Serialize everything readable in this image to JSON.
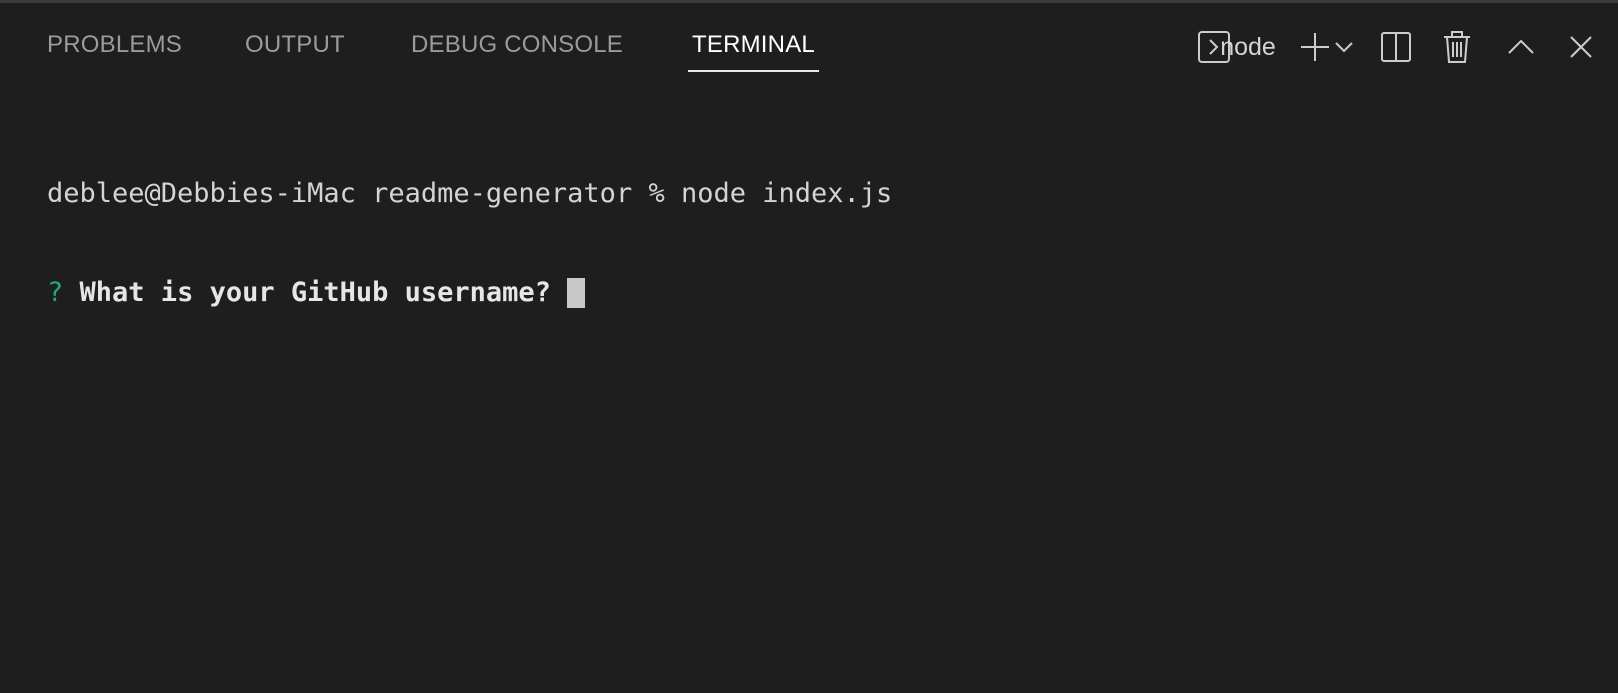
{
  "tabs": [
    {
      "label": "PROBLEMS",
      "active": false
    },
    {
      "label": "OUTPUT",
      "active": false
    },
    {
      "label": "DEBUG CONSOLE",
      "active": false
    },
    {
      "label": "TERMINAL",
      "active": true
    }
  ],
  "toolbar": {
    "terminal_name": "node",
    "icons": [
      "terminal-icon",
      "plus-icon",
      "chevron-down-icon",
      "split-icon",
      "trash-icon",
      "chevron-up-icon",
      "close-icon"
    ]
  },
  "terminal": {
    "prompt_line": "deblee@Debbies-iMac readme-generator % node index.js",
    "question_mark": "?",
    "question_text": "What is your GitHub username?"
  },
  "colors": {
    "background": "#1e1e1e",
    "active_tab": "#ffffff",
    "inactive_tab": "#9b9b9b",
    "question_mark": "#23a876"
  }
}
